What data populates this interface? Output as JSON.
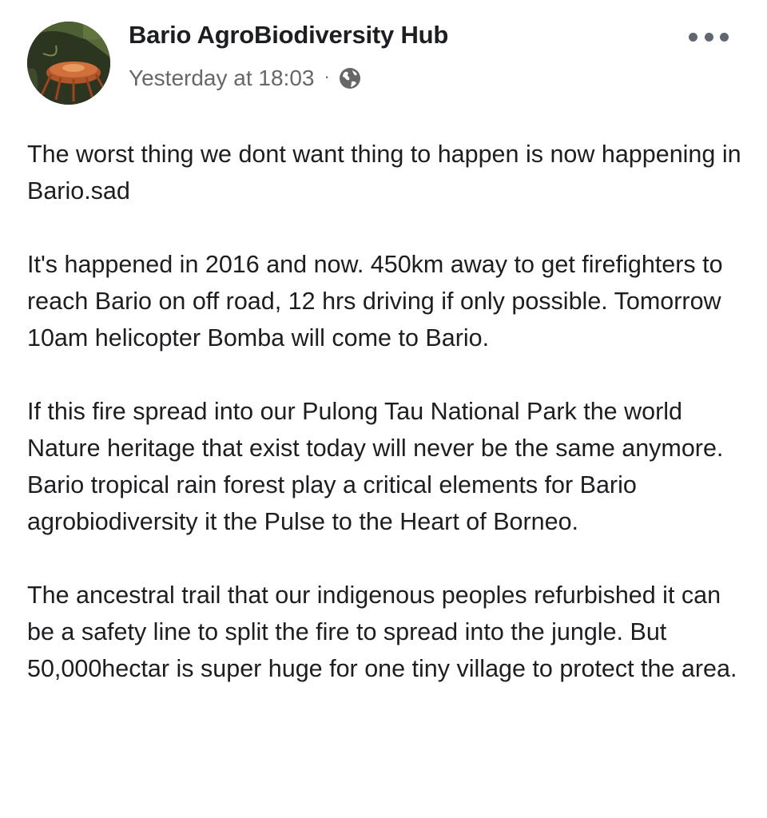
{
  "post": {
    "page_name": "Bario AgroBiodiversity Hub",
    "timestamp": "Yesterday at 18:03",
    "separator": "·",
    "privacy_icon": "globe-icon",
    "more_icon": "more-options-icon",
    "avatar_icon": "page-avatar-mushroom",
    "paragraphs": [
      "The worst thing we dont want thing to happen is now happening in Bario.sad",
      "It's happened in 2016 and now. 450km away to get firefighters to reach Bario on off road, 12 hrs driving if only possible. Tomorrow 10am helicopter Bomba will come to Bario.",
      "If this fire spread into our Pulong Tau National Park the world Nature heritage that exist today will never be the same anymore. Bario tropical rain forest play a critical elements for Bario agrobiodiversity it the Pulse to the Heart of Borneo.",
      "The ancestral trail that our indigenous peoples refurbished it can be a safety line to split the fire to spread into the jungle. But 50,000hectar is super huge for one tiny village to protect the area."
    ]
  },
  "colors": {
    "text_primary": "#1c1e21",
    "text_secondary": "#65676b",
    "icon_gray": "#606770",
    "background": "#ffffff"
  }
}
